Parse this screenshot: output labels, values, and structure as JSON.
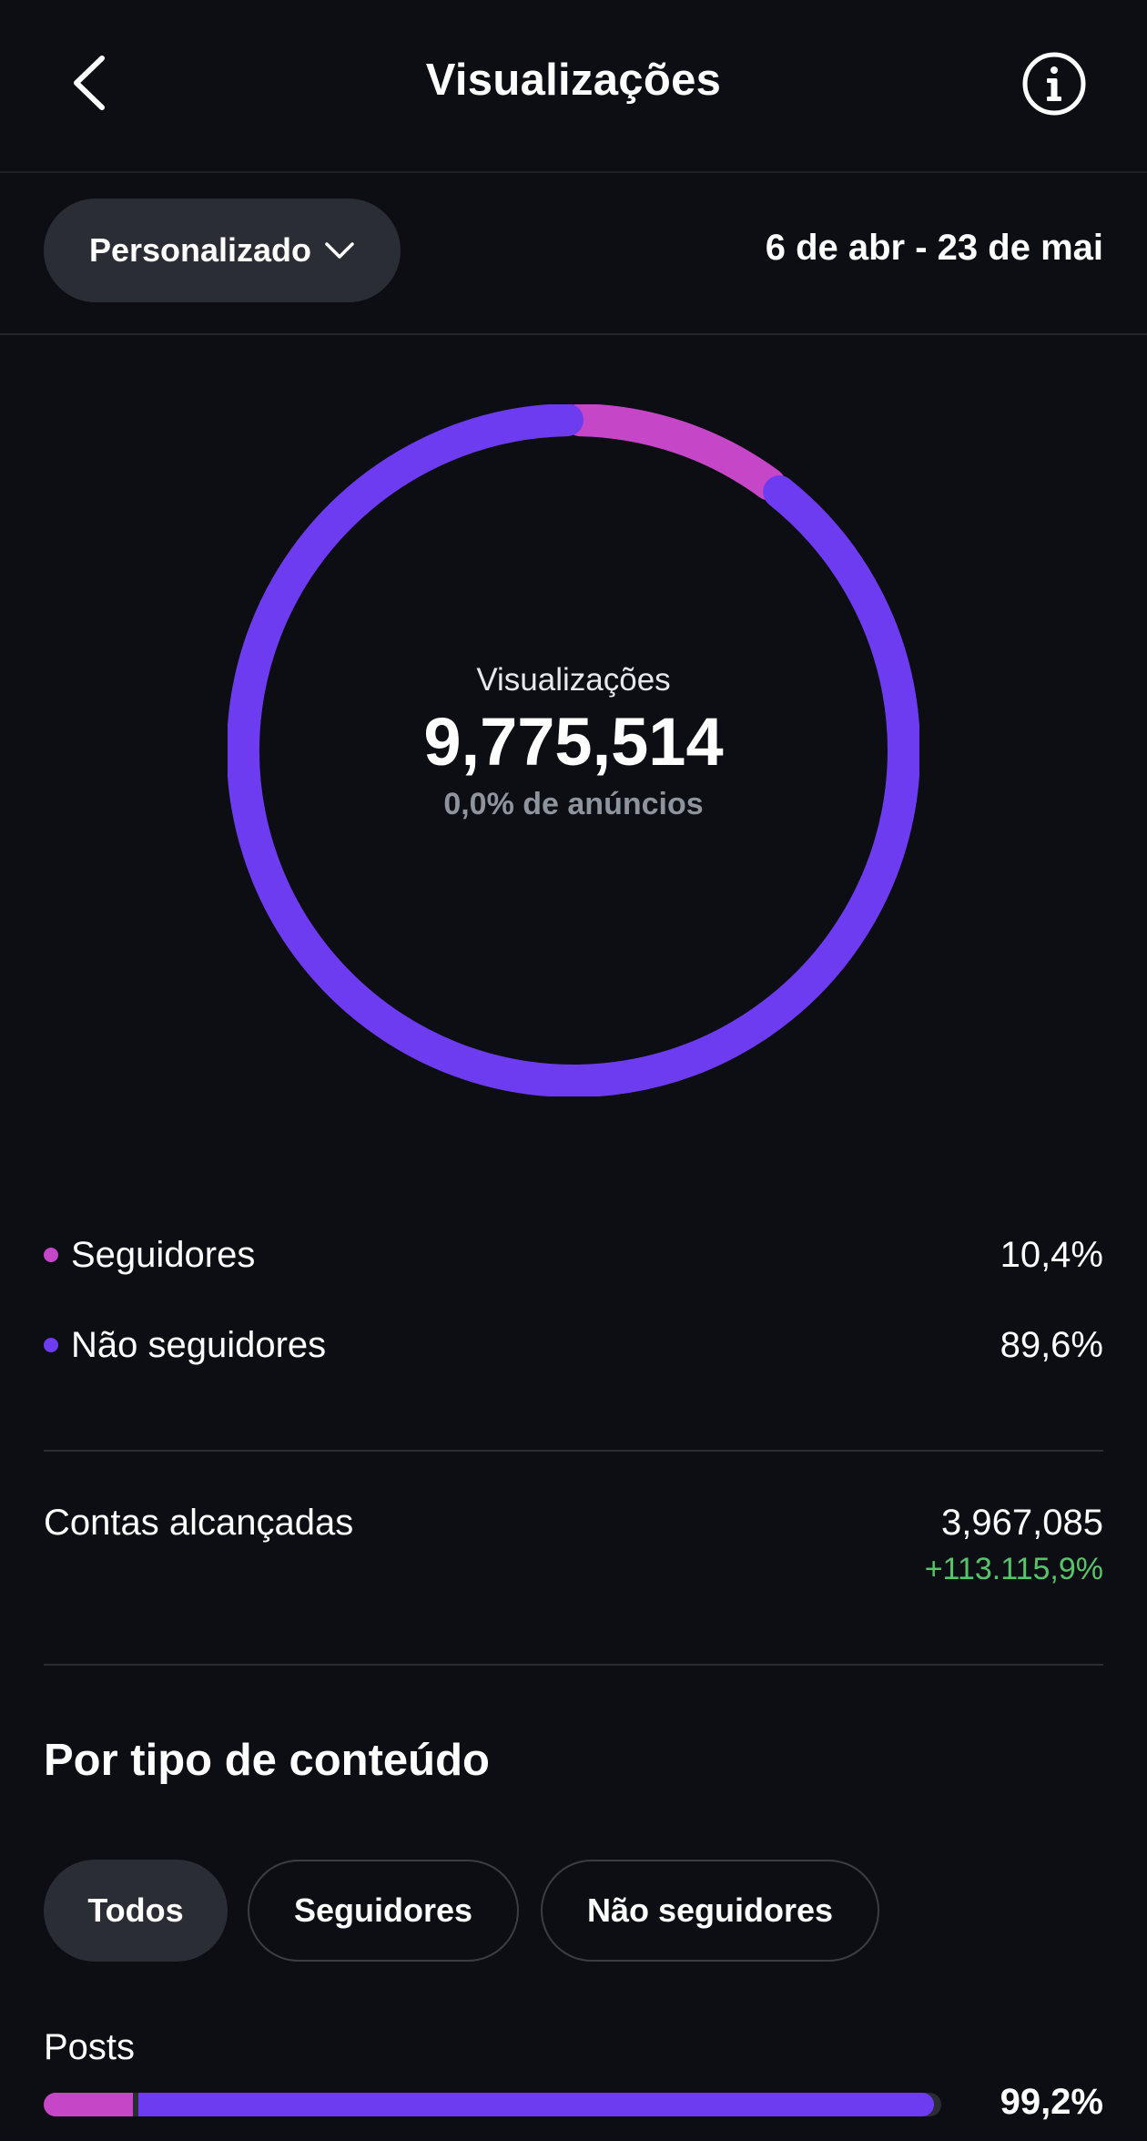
{
  "header": {
    "title": "Visualizações",
    "back_icon": "chevron-left-icon",
    "info_icon": "info-icon"
  },
  "filter": {
    "period_label": "Personalizado",
    "period_icon": "chevron-down-icon",
    "date_range": "6 de abr - 23 de mai"
  },
  "summary": {
    "label": "Visualizações",
    "value": "9,775,514",
    "ads_note": "0,0% de anúncios"
  },
  "colors": {
    "followers": "#c646c8",
    "non_followers": "#6e3cf0",
    "positive": "#58c46a",
    "background": "#0c0e14"
  },
  "chart_data": {
    "type": "pie",
    "categories": [
      "Seguidores",
      "Não seguidores"
    ],
    "values": [
      10.4,
      89.6
    ]
  },
  "legend": [
    {
      "label": "Seguidores",
      "value": "10,4%"
    },
    {
      "label": "Não seguidores",
      "value": "89,6%"
    }
  ],
  "reach": {
    "label": "Contas alcançadas",
    "value": "3,967,085",
    "change": "+113.115,9%"
  },
  "content_type": {
    "title": "Por tipo de conteúdo",
    "tabs": [
      {
        "label": "Todos",
        "active": true
      },
      {
        "label": "Seguidores",
        "active": false
      },
      {
        "label": "Não seguidores",
        "active": false
      }
    ],
    "rows": [
      {
        "label": "Posts",
        "value": "99,2%",
        "total_fraction": 0.992,
        "followers_fraction": 0.1
      }
    ]
  }
}
